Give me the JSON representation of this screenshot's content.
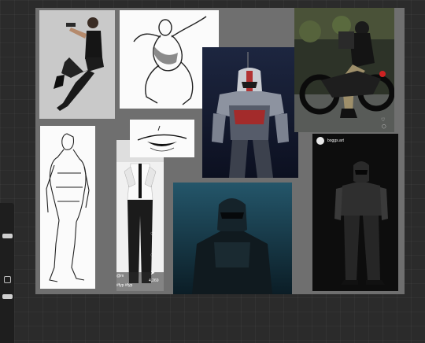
{
  "canvas": {
    "background": "#6f6f6f",
    "references": [
      {
        "id": "gun-pose-photo",
        "icon": "photo"
      },
      {
        "id": "leaping-figure-sketch",
        "icon": "sketch"
      },
      {
        "id": "armored-soldier-render",
        "icon": "render"
      },
      {
        "id": "motorcycle-rider-photo",
        "icon": "photo"
      },
      {
        "id": "standing-figure-sketch",
        "icon": "sketch"
      },
      {
        "id": "mouth-sketch",
        "icon": "sketch"
      },
      {
        "id": "suited-person-video",
        "icon": "video"
      },
      {
        "id": "helmet-soldier-dark-still",
        "icon": "render"
      },
      {
        "id": "armored-suit-post",
        "icon": "photo"
      }
    ]
  },
  "posts": {
    "armored_suit": {
      "username": "boggs.art"
    },
    "suited_person": {
      "likes": "",
      "comments": "",
      "shares": "4,269",
      "handle": "@m",
      "caption": "#fyp #fyp"
    }
  }
}
